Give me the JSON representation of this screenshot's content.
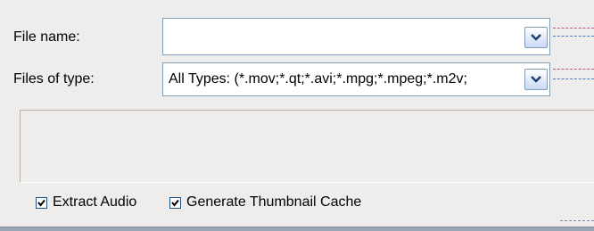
{
  "fields": {
    "file_name": {
      "label": "File name:",
      "value": ""
    },
    "file_type": {
      "label": "Files of type:",
      "value": "All Types: (*.mov;*.qt;*.avi;*.mpg;*.mpeg;*.m2v;"
    }
  },
  "options": {
    "extract_audio": {
      "label": "Extract Audio",
      "checked": true
    },
    "generate_thumbnail_cache": {
      "label": "Generate Thumbnail Cache",
      "checked": true
    }
  },
  "icons": {
    "dropdown": "chevron-down-icon",
    "check": "checkmark-icon"
  },
  "colors": {
    "window_bg": "#efedeb",
    "field_border": "#7f9db9",
    "button_gradient_end": "#c9d8f5"
  }
}
